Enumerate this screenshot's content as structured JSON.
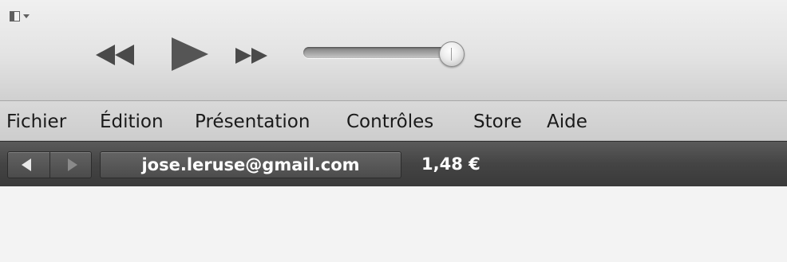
{
  "icons": {
    "sidebar_toggle": "sidebar-toggle-icon",
    "rewind": "rewind-icon",
    "play": "play-icon",
    "fast_forward": "fast-forward-icon",
    "nav_back": "back-arrow-icon",
    "nav_forward": "forward-arrow-icon"
  },
  "player": {
    "volume_level": 0.95
  },
  "menu": {
    "items": [
      {
        "label": "Fichier"
      },
      {
        "label": "Édition"
      },
      {
        "label": "Présentation"
      },
      {
        "label": "Contrôles"
      },
      {
        "label": "Store"
      },
      {
        "label": "Aide"
      }
    ]
  },
  "store": {
    "account": "jose.leruse@gmail.com",
    "balance": "1,48 €"
  },
  "colors": {
    "toolbar_bg": "#e3e3e3",
    "menubar_bg": "#d3d3d3",
    "storebar_bg": "#444444",
    "text_light": "#ffffff"
  }
}
